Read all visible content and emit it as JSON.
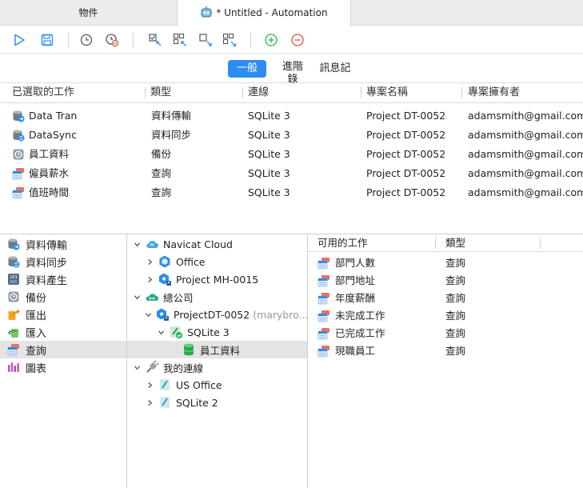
{
  "tabs": [
    {
      "label": "物件"
    },
    {
      "label": "* Untitled - Automation"
    }
  ],
  "segments": [
    {
      "label": "一般"
    },
    {
      "label_line1": "進階",
      "label_line2": "錄"
    },
    {
      "label": "訊息記"
    }
  ],
  "job_table": {
    "headers": [
      "已選取的工作",
      "類型",
      "連線",
      "專案名稱",
      "專案擁有者"
    ],
    "rows": [
      {
        "icon": "data-transfer-icon",
        "name": "Data Tran",
        "type": "資料傳輸",
        "connection": "SQLite 3",
        "project": "Project DT-0052",
        "owner": "adamsmith@gmail.com"
      },
      {
        "icon": "data-sync-icon",
        "name": "DataSync",
        "type": "資料同步",
        "connection": "SQLite 3",
        "project": "Project DT-0052",
        "owner": "adamsmith@gmail.com"
      },
      {
        "icon": "backup-icon",
        "name": "員工資料",
        "type": "備份",
        "connection": "SQLite 3",
        "project": "Project DT-0052",
        "owner": "adamsmith@gmail.com"
      },
      {
        "icon": "query-icon",
        "name": "僱員薪水",
        "type": "查詢",
        "connection": "SQLite 3",
        "project": "Project DT-0052",
        "owner": "adamsmith@gmail.com"
      },
      {
        "icon": "query-icon",
        "name": "值班時間",
        "type": "查詢",
        "connection": "SQLite 3",
        "project": "Project DT-0052",
        "owner": "adamsmith@gmail.com"
      }
    ]
  },
  "categories": [
    {
      "icon": "data-transfer-icon",
      "label": "資料傳輸"
    },
    {
      "icon": "data-sync-icon",
      "label": "資料同步"
    },
    {
      "icon": "data-generation-icon",
      "label": "資料產生"
    },
    {
      "icon": "backup-icon",
      "label": "備份"
    },
    {
      "icon": "export-icon",
      "label": "匯出"
    },
    {
      "icon": "import-icon",
      "label": "匯入"
    },
    {
      "icon": "query-icon",
      "label": "查詢"
    },
    {
      "icon": "chart-icon",
      "label": "圖表"
    }
  ],
  "tree": [
    {
      "label": "Navicat Cloud",
      "icon": "cloud-icon"
    },
    {
      "label": "Office",
      "icon": "project-icon"
    },
    {
      "label": "Project MH-0015",
      "icon": "shared-project-icon"
    },
    {
      "label": "總公司",
      "icon": "cloud-group-icon"
    },
    {
      "label": "ProjectDT-0052",
      "suffix": "(marybro...",
      "icon": "shared-project-icon"
    },
    {
      "label": "SQLite 3",
      "icon": "sqlite-connected-icon"
    },
    {
      "label": "員工資料",
      "icon": "database-icon"
    },
    {
      "label": "我的連線",
      "icon": "connections-icon"
    },
    {
      "label": "US Office",
      "icon": "sqlite-icon"
    },
    {
      "label": "SQLite 2",
      "icon": "sqlite-icon"
    }
  ],
  "available": {
    "headers": [
      "可用的工作",
      "類型"
    ],
    "rows": [
      {
        "name": "部門人數",
        "type": "查詢"
      },
      {
        "name": "部門地址",
        "type": "查詢"
      },
      {
        "name": "年度薪酬",
        "type": "查詢"
      },
      {
        "name": "未完成工作",
        "type": "查詢"
      },
      {
        "name": "已完成工作",
        "type": "查詢"
      },
      {
        "name": "現職員工",
        "type": "查詢"
      }
    ]
  },
  "colors": {
    "accent": "#2d8cf0",
    "run": "#2d8cf0",
    "add": "#2bb24c",
    "remove": "#e04848"
  }
}
